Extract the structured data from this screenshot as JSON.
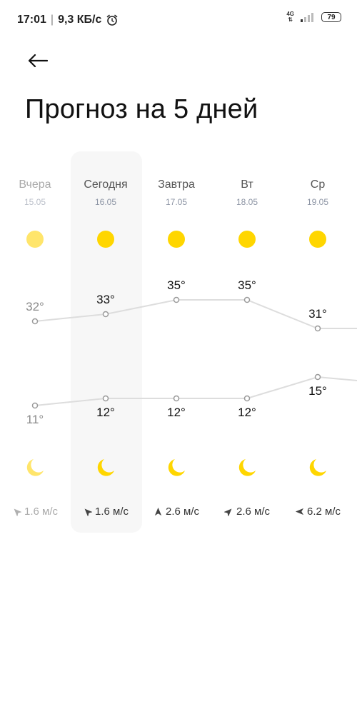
{
  "status_bar": {
    "time": "17:01",
    "data_rate": "9,3 КБ/с",
    "network": "4G",
    "battery": "79"
  },
  "header": {
    "title": "Прогноз на 5 дней"
  },
  "colors": {
    "sun": "#ffd600",
    "sun_past": "#ffe56b",
    "line": "#dddddd",
    "today_bg": "#f7f7f7"
  },
  "days": [
    {
      "name": "Вчера",
      "date": "15.05",
      "high": "32°",
      "low": "11°",
      "wind": "1.6 м/с",
      "wind_dir": "northwest",
      "past": true
    },
    {
      "name": "Сегодня",
      "date": "16.05",
      "high": "33°",
      "low": "12°",
      "wind": "1.6 м/с",
      "wind_dir": "northwest",
      "past": false
    },
    {
      "name": "Завтра",
      "date": "17.05",
      "high": "35°",
      "low": "12°",
      "wind": "2.6 м/с",
      "wind_dir": "north",
      "past": false
    },
    {
      "name": "Вт",
      "date": "18.05",
      "high": "35°",
      "low": "12°",
      "wind": "2.6 м/с",
      "wind_dir": "northeast",
      "past": false
    },
    {
      "name": "Ср",
      "date": "19.05",
      "high": "31°",
      "low": "15°",
      "wind": "6.2 м/с",
      "wind_dir": "west",
      "past": false
    }
  ],
  "chart_data": {
    "type": "line",
    "x": [
      "15.05",
      "16.05",
      "17.05",
      "18.05",
      "19.05"
    ],
    "series": [
      {
        "values": [
          32,
          33,
          35,
          35,
          31
        ]
      },
      {
        "values": [
          11,
          12,
          12,
          12,
          15
        ]
      }
    ]
  }
}
